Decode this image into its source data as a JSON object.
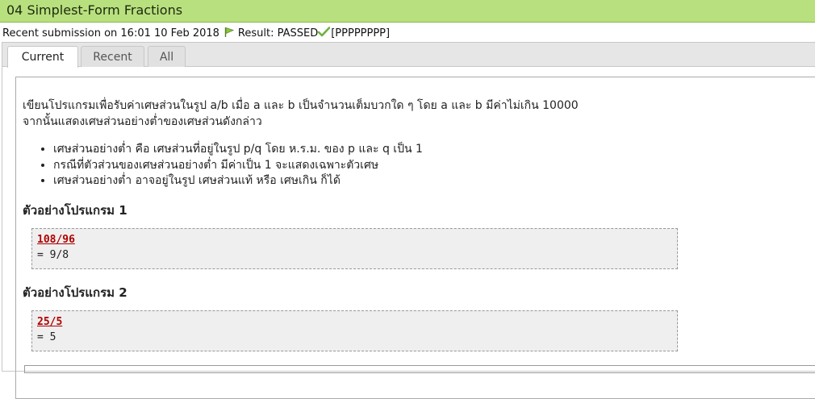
{
  "header": {
    "title": "04 Simplest-Form Fractions",
    "title_bar_color": "#b9e07e"
  },
  "submission": {
    "prefix": "Recent submission on 16:01 10 Feb 2018",
    "flag_icon": "green-flag-icon",
    "result_label": "Result: PASSED",
    "check_icon": "green-check-icon",
    "result_code": "[PPPPPPPP]"
  },
  "tabs": [
    {
      "label": "Current",
      "active": true
    },
    {
      "label": "Recent",
      "active": false
    },
    {
      "label": "All",
      "active": false
    }
  ],
  "problem": {
    "line1": "เขียนโปรแกรมเพื่อรับค่าเศษส่วนในรูป a/b เมื่อ a และ b เป็นจำนวนเต็มบวกใด ๆ โดย a และ b มีค่าไม่เกิน 10000",
    "line2": "จากนั้นแสดงเศษส่วนอย่างต่ำของเศษส่วนดังกล่าว",
    "bullets": [
      "เศษส่วนอย่างต่ำ คือ เศษส่วนที่อยู่ในรูป p/q โดย ห.ร.ม. ของ p และ q เป็น 1",
      "กรณีที่ตัวส่วนของเศษส่วนอย่างต่ำ มีค่าเป็น 1 จะแสดงเฉพาะตัวเศษ",
      "เศษส่วนอย่างต่ำ อาจอยู่ในรูป เศษส่วนแท้ หรือ เศษเกิน ก็ได้"
    ]
  },
  "examples": [
    {
      "heading": "ตัวอย่างโปรแกรม 1",
      "input": "108/96",
      "output": "= 9/8"
    },
    {
      "heading": "ตัวอย่างโปรแกรม 2",
      "input": "25/5",
      "output": "= 5"
    }
  ],
  "colors": {
    "input_text": "#b00000",
    "example_bg": "#efefef"
  }
}
